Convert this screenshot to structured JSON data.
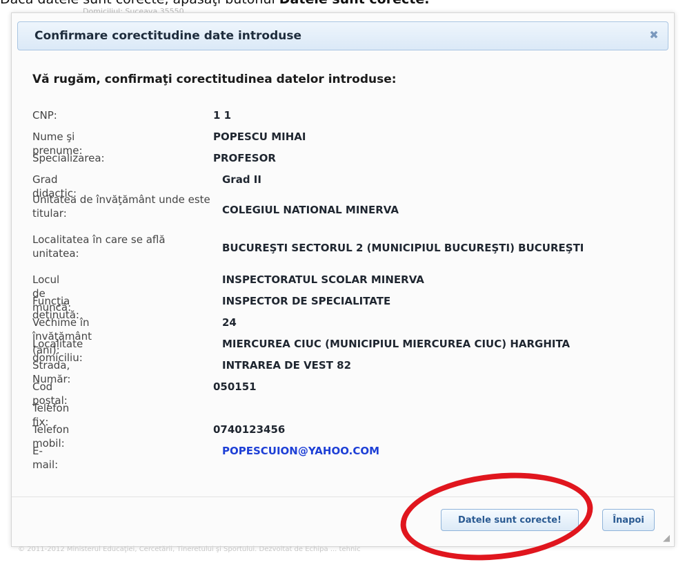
{
  "instruction": {
    "prefix": "Dacă datele sunt corecte, apăsaţi butonul ",
    "button_ref": "Datele sunt corecte."
  },
  "background_faint": "Domiciliul:                    Suceava 35550",
  "dialog": {
    "title": "Confirmare corectitudine date introduse",
    "heading": "Vă rugăm, confirmaţi corectitudinea datelor introduse:",
    "fields": [
      {
        "label": "CNP:",
        "value": "1                          1"
      },
      {
        "label": "Nume şi prenume:",
        "value": "POPESCU MIHAI"
      },
      {
        "label": "Specializarea:",
        "value": "PROFESOR"
      },
      {
        "label": "Grad didactic:",
        "value": "Grad II"
      },
      {
        "label": "Unitatea de învăţământ unde este titular:",
        "value": "COLEGIUL NATIONAL MINERVA"
      },
      {
        "label": "Localitatea în care se află unitatea:",
        "value": "BUCUREŞTI SECTORUL 2 (MUNICIPIUL BUCUREŞTI) BUCUREŞTI"
      },
      {
        "label": "Locul de muncă:",
        "value": "INSPECTORATUL SCOLAR MINERVA"
      },
      {
        "label": "Funcţia deţinută:",
        "value": "INSPECTOR DE SPECIALITATE"
      },
      {
        "label": "Vechime în învăţământ (ani):",
        "value": "24"
      },
      {
        "label": "Localitate domiciliu:",
        "value": "MIERCUREA CIUC (MUNICIPIUL MIERCUREA CIUC) HARGHITA"
      },
      {
        "label": "Strada, Număr:",
        "value": "INTRAREA DE VEST 82"
      },
      {
        "label": "Cod poştal:",
        "value": "050151"
      },
      {
        "label": "Telefon fix:",
        "value": ""
      },
      {
        "label": "Telefon mobil:",
        "value": "0740123456"
      },
      {
        "label": "E-mail:",
        "value": "POPESCUION@YAHOO.COM"
      }
    ],
    "buttons": {
      "confirm": "Datele sunt corecte!",
      "back": "Înapoi"
    },
    "close_icon": "close-icon"
  },
  "footer_text": "© 2011-2012 Ministerul Educaţiei, Cercetării, Tineretului şi Sportului. Dezvoltat de Echipa ... tehnic",
  "colors": {
    "title_bg": "#dbe9f7",
    "link": "#1d3fd6",
    "highlight_circle": "#e0161e"
  }
}
